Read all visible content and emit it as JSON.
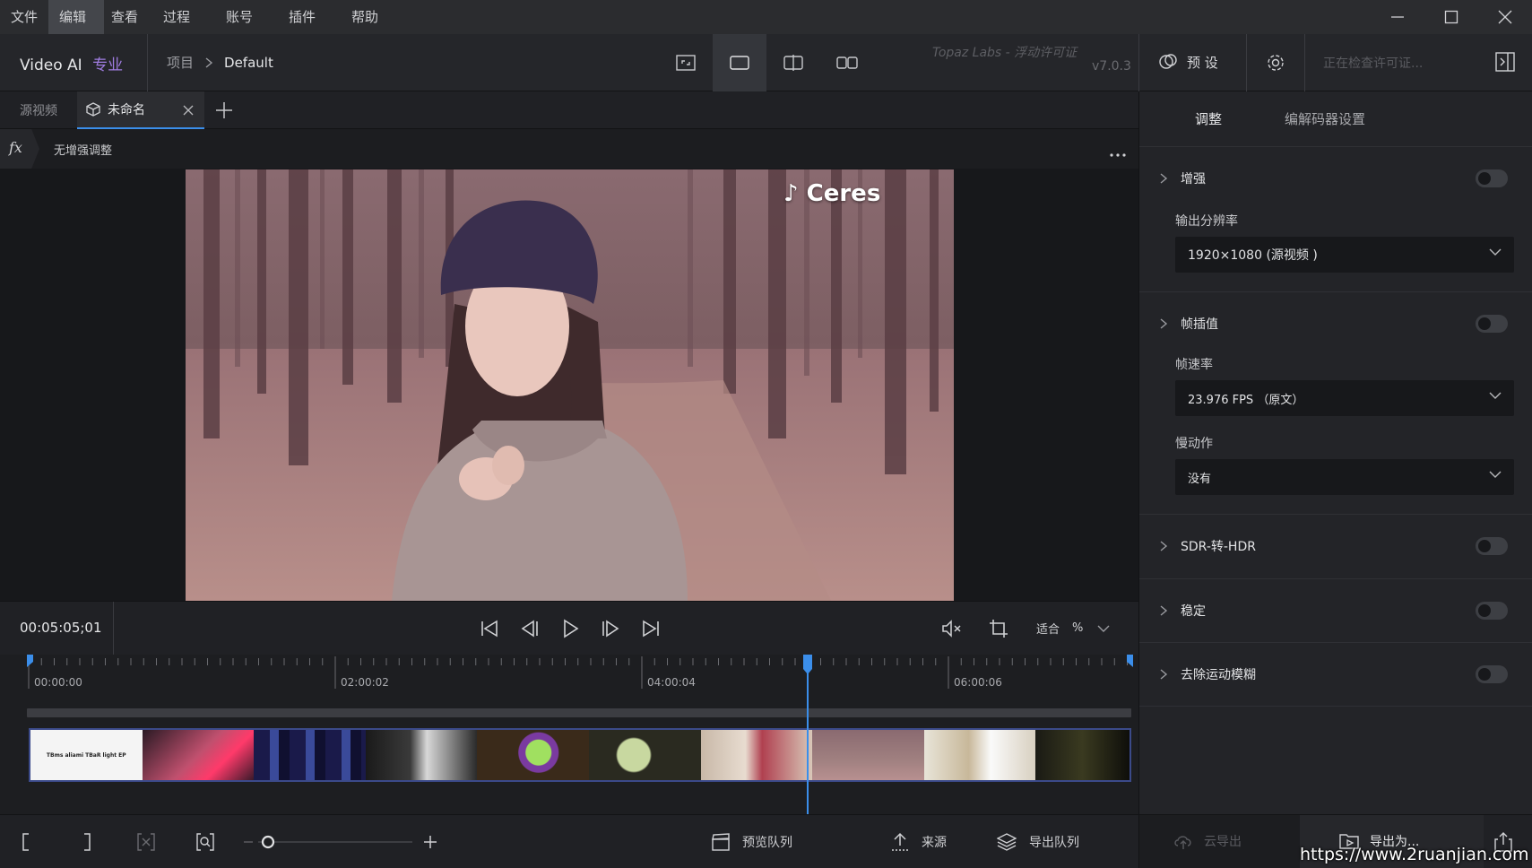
{
  "menu": {
    "items": [
      {
        "label": "文件"
      },
      {
        "label": "编辑"
      },
      {
        "label": "查看"
      },
      {
        "label": "过程"
      },
      {
        "label": "账号"
      },
      {
        "label": "插件"
      },
      {
        "label": "帮助"
      }
    ]
  },
  "toolbar": {
    "app_name": "Video AI",
    "app_edition": "专业",
    "breadcrumb_root": "项目",
    "breadcrumb_current": "Default",
    "license_text": "Topaz Labs - 浮动许可证",
    "version": "v7.0.3",
    "preset_label": "预 设",
    "license_status": "正在检查许可证..."
  },
  "tabs": {
    "source_label": "源视频",
    "active_label": "未命名"
  },
  "fxbar": {
    "fx_symbol": "fx",
    "label": "无增强调整"
  },
  "preview": {
    "watermark": "♪ Ceres"
  },
  "playback": {
    "timecode": "00:05:05;01",
    "zoom_label": "适合",
    "zoom_unit": "%"
  },
  "timeline": {
    "ticks": [
      "00:00:00",
      "02:00:02",
      "04:00:04",
      "06:00:06"
    ],
    "first_thumb_text": "TBms aliami TBaR light EP"
  },
  "bottombar": {
    "preview_queue": "预览队列",
    "source": "来源",
    "export_queue": "导出队列",
    "cloud_export": "云导出",
    "export_as": "导出为...",
    "watermark_url": "https://www.2ruanjian.com"
  },
  "panel": {
    "tab_adjust": "调整",
    "tab_codec": "编解码器设置",
    "enhance": "增强",
    "output_res_label": "输出分辨率",
    "output_res_value": "1920×1080 (源视频 )",
    "frame_interp": "帧插值",
    "frame_rate_label": "帧速率",
    "frame_rate_value": "23.976 FPS （原文）",
    "slowmo_label": "慢动作",
    "slowmo_value": "没有",
    "sdr_hdr": "SDR-转-HDR",
    "stabilize": "稳定",
    "motion_blur": "去除运动模糊"
  },
  "colors": {
    "accent": "#3b8eea",
    "edition": "#a07ce0",
    "background": "#1b1c1f"
  }
}
